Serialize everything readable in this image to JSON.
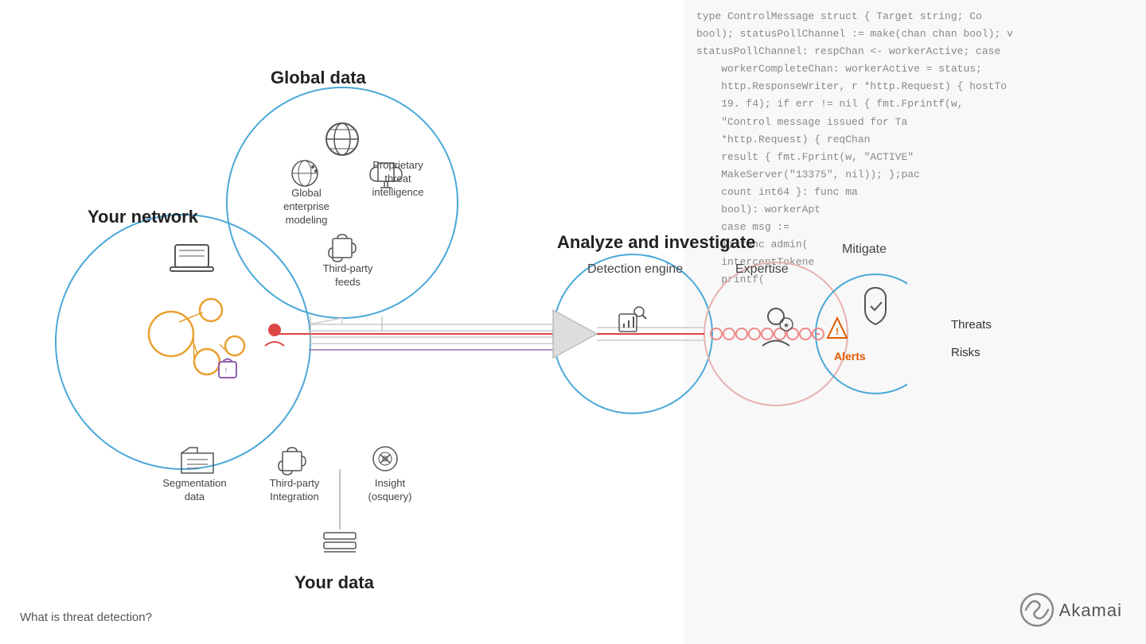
{
  "code_lines": [
    "type ControlMessage struct { Target string; Co",
    "bool); statusPollChannel := make(chan chan bool); v",
    "statusPollChannel: respChan <- workerActive; case",
    "    workerCompleteChan: workerActive = status;",
    "    http.ResponseWriter, r *http.Request) { hostTo",
    "    19. f4); if err != nil { fmt.Fprintf(w,",
    "    Control message issued for Ta",
    "    *http.Request) { reqChan",
    "    result { fmt.Fprint(w, \"ACTIVE\"",
    "    MakeServer(\"13375\", nil)); };pac",
    "    count int64 }: func ma",
    "    bool): workerApt",
    "    case msg :=",
    "    }; func admin(",
    "    interceptTokene",
    "    printf(",
    ""
  ],
  "sections": {
    "your_network": "Your network",
    "global_data": "Global data",
    "analyze": "Analyze and investigate",
    "detection_engine": "Detection engine",
    "expertise": "Expertise",
    "mitigate": "Mitigate",
    "your_data": "Your data",
    "alerts": "Alerts",
    "threats": "Threats",
    "risks": "Risks"
  },
  "icons": {
    "laptop": "💻",
    "globe": "🌐",
    "trophy": "🏆",
    "puzzle": "🧩",
    "chart": "📊",
    "folder": "📁",
    "database": "🗄",
    "search": "🔍",
    "person": "👤",
    "shield": "🛡",
    "warning": "⚠",
    "person_threat": "👾",
    "bag": "🛍"
  },
  "labels": {
    "global_enterprise_modeling": "Global enterprise\nmodeling",
    "proprietary_threat_intelligence": "Proprietary\nthreat\nintelligence",
    "third_party_feeds": "Third-party\nfeeds",
    "segmentation_data": "Segmentation\ndata",
    "third_party_integration": "Third-party\nIntegration",
    "insight": "Insight\n(osquery)",
    "bottom_question": "What is threat detection?"
  },
  "akamai": {
    "name": "Akamai"
  }
}
